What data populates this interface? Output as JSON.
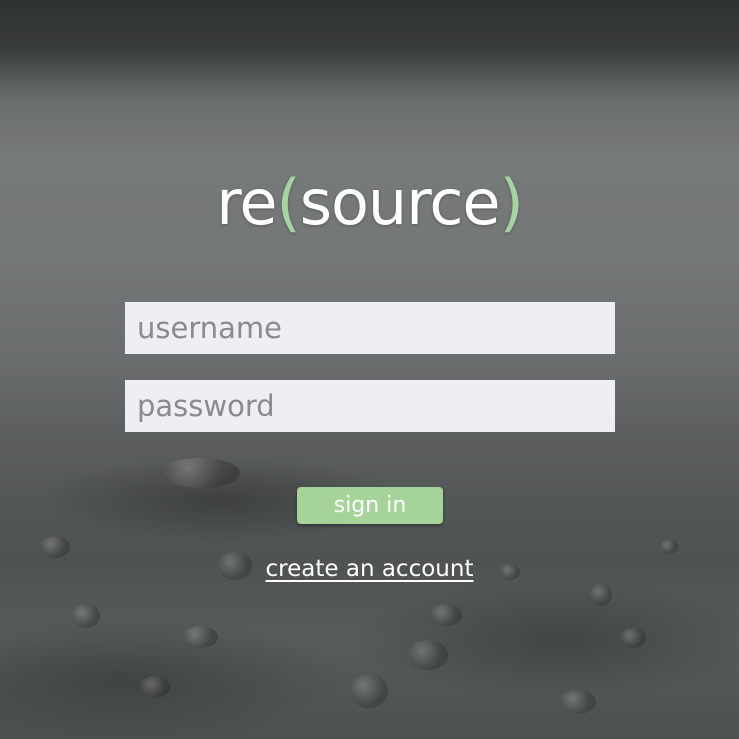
{
  "logo": {
    "prefix": "re",
    "open_paren": "(",
    "middle": "source",
    "close_paren": ")",
    "accent_color": "#a6d4a0"
  },
  "login_form": {
    "username_placeholder": "username",
    "password_placeholder": "password",
    "sign_in_label": "sign in",
    "sign_in_color": "#a5d39a"
  },
  "create_account_link": "create an account"
}
